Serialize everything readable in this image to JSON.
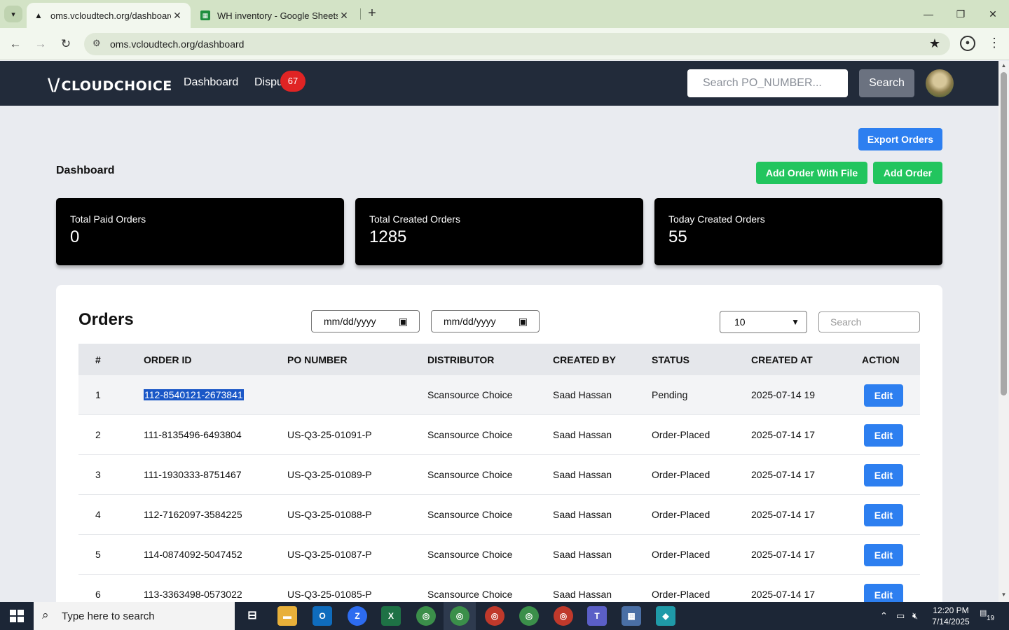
{
  "browser": {
    "tabs": [
      {
        "title": "oms.vcloudtech.org/dashboard",
        "active": true
      },
      {
        "title": "WH inventory - Google Sheets",
        "active": false
      }
    ],
    "url": "oms.vcloudtech.org/dashboard"
  },
  "navbar": {
    "logo": "CLOUDCHOICE",
    "links": [
      "Dashboard",
      "Dispu"
    ],
    "disputes_badge": "67",
    "search_placeholder": "Search PO_NUMBER...",
    "search_button": "Search"
  },
  "actions": {
    "export": "Export Orders",
    "add_with_file": "Add Order With File",
    "add": "Add Order"
  },
  "page_title": "Dashboard",
  "stats": [
    {
      "label": "Total Paid Orders",
      "value": "0"
    },
    {
      "label": "Total Created Orders",
      "value": "1285"
    },
    {
      "label": "Today Created Orders",
      "value": "55"
    }
  ],
  "orders": {
    "title": "Orders",
    "date_from": "mm/dd/yyyy",
    "date_to": "mm/dd/yyyy",
    "page_size": "10",
    "search_placeholder": "Search",
    "columns": [
      "#",
      "ORDER ID",
      "PO NUMBER",
      "DISTRIBUTOR",
      "CREATED BY",
      "STATUS",
      "CREATED AT",
      "ACTION"
    ],
    "rows": [
      {
        "n": "1",
        "order_id": "112-8540121-2673841",
        "po": "",
        "distributor": "Scansource Choice",
        "created_by": "Saad Hassan",
        "status": "Pending",
        "created_at": "2025-07-14 19",
        "action": "Edit"
      },
      {
        "n": "2",
        "order_id": "111-8135496-6493804",
        "po": "US-Q3-25-01091-P",
        "distributor": "Scansource Choice",
        "created_by": "Saad Hassan",
        "status": "Order-Placed",
        "created_at": "2025-07-14 17",
        "action": "Edit"
      },
      {
        "n": "3",
        "order_id": "111-1930333-8751467",
        "po": "US-Q3-25-01089-P",
        "distributor": "Scansource Choice",
        "created_by": "Saad Hassan",
        "status": "Order-Placed",
        "created_at": "2025-07-14 17",
        "action": "Edit"
      },
      {
        "n": "4",
        "order_id": "112-7162097-3584225",
        "po": "US-Q3-25-01088-P",
        "distributor": "Scansource Choice",
        "created_by": "Saad Hassan",
        "status": "Order-Placed",
        "created_at": "2025-07-14 17",
        "action": "Edit"
      },
      {
        "n": "5",
        "order_id": "114-0874092-5047452",
        "po": "US-Q3-25-01087-P",
        "distributor": "Scansource Choice",
        "created_by": "Saad Hassan",
        "status": "Order-Placed",
        "created_at": "2025-07-14 17",
        "action": "Edit"
      },
      {
        "n": "6",
        "order_id": "113-3363498-0573022",
        "po": "US-Q3-25-01085-P",
        "distributor": "Scansource Choice",
        "created_by": "Saad Hassan",
        "status": "Order-Placed",
        "created_at": "2025-07-14 17",
        "action": "Edit"
      }
    ]
  },
  "taskbar": {
    "search_text": "Type here to search",
    "time": "12:20 PM",
    "date": "7/14/2025",
    "notification_count": "19"
  },
  "colors": {
    "navbar_bg": "#222b3a",
    "primary_blue": "#2d7ff0",
    "green": "#22c55e",
    "badge_red": "#e02424"
  }
}
